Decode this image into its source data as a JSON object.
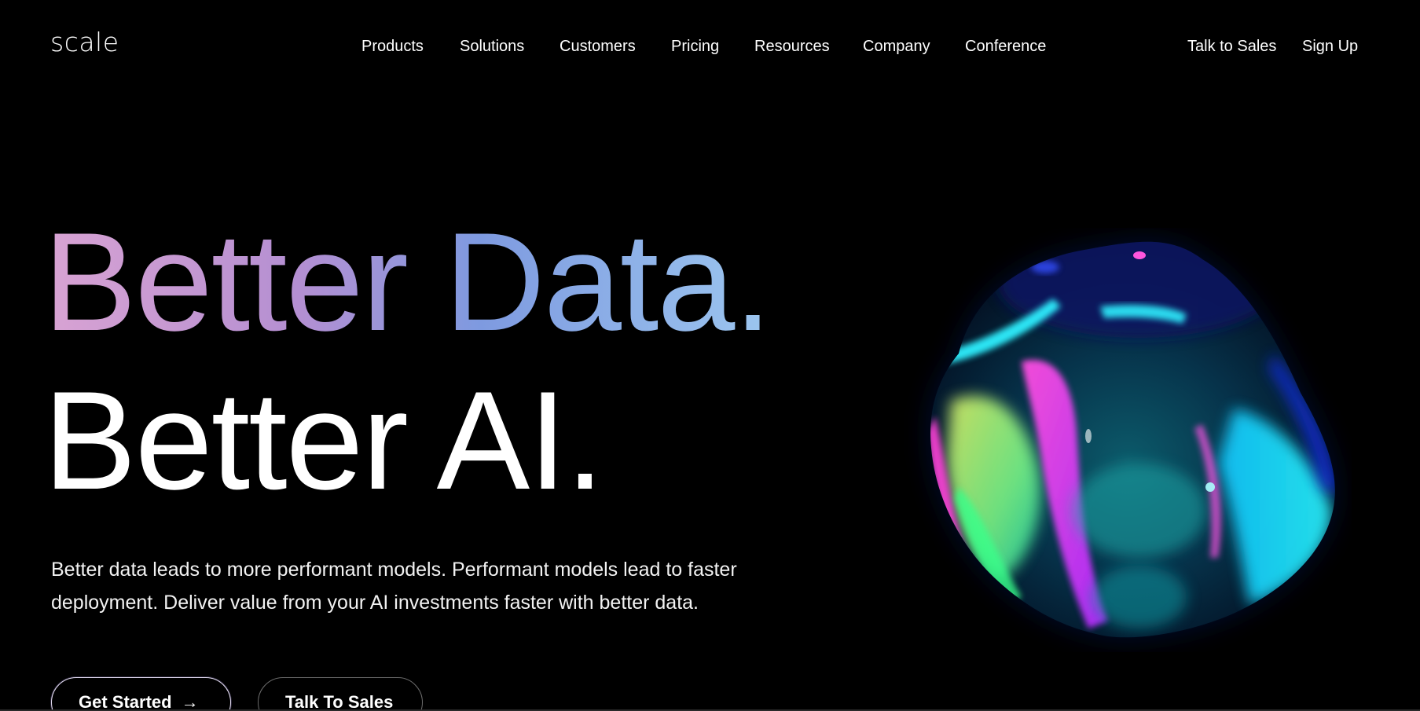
{
  "header": {
    "logo": "scale",
    "nav": {
      "products": "Products",
      "solutions": "Solutions",
      "customers": "Customers",
      "pricing": "Pricing",
      "resources": "Resources",
      "company": "Company",
      "conference": "Conference"
    },
    "talk_to_sales": "Talk to Sales",
    "sign_up": "Sign Up"
  },
  "hero": {
    "headline_line1": "Better Data.",
    "headline_line2": "Better AI.",
    "subtext": "Better data leads to more performant models. Performant models lead to faster deployment. Deliver value from your AI investments faster with better data.",
    "primary_button": "Get Started",
    "primary_button_icon": "arrow-right-icon",
    "secondary_button": "Talk To Sales"
  },
  "colors": {
    "background": "#000000",
    "text": "#ffffff",
    "headline_gradient_start": "#d9a3d3",
    "headline_gradient_mid": "#7e9ae0",
    "headline_gradient_end": "#9cc6ef",
    "blob_accents": [
      "#ff3fd6",
      "#18f0ff",
      "#7cff7a",
      "#ffe34d",
      "#1b2fff"
    ]
  }
}
